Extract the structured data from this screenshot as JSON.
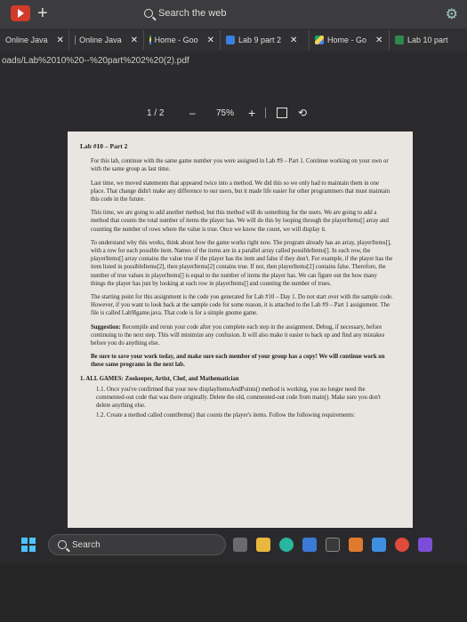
{
  "topbar": {
    "search_label": "Search the web"
  },
  "tabs": [
    {
      "label": "Online Java"
    },
    {
      "label": "Online Java"
    },
    {
      "label": "Home - Goo"
    },
    {
      "label": "Lab 9 part 2"
    },
    {
      "label": "Home - Go"
    },
    {
      "label": "Lab 10 part"
    }
  ],
  "address": {
    "url": "oads/Lab%2010%20--%20part%202%20(2).pdf"
  },
  "pdf_toolbar": {
    "page": "1 / 2",
    "minus": "–",
    "zoom": "75%",
    "plus": "+"
  },
  "document": {
    "title": "Lab #10 – Part 2",
    "paragraphs": [
      "For this lab, continue with the same game number you were assigned in Lab #9 – Part 1. Continue working on your own or with the same group as last time.",
      "Last time, we moved statements that appeared twice into a method. We did this so we only had to maintain them in one place. That change didn't make any difference to our users, but it made life easier for other programmers that must maintain this code in the future.",
      "This time, we are going to add another method, but this method will do something for the users. We are going to add a method that counts the total number of items the player has. We will do this by looping through the playerItems[] array and counting the number of rows where the value is true. Once we know the count, we will display it.",
      "To understand why this works, think about how the game works right now. The program already has an array, playerItems[], with a row for each possible item. Names of the items are in a parallel array called possibleItems[]. In each row, the playerItems[] array contains the value true if the player has the item and false if they don't. For example, if the player has the item listed in possibleItems[2], then playerItems[2] contains true. If not, then playerItems[2] contains false. Therefore, the number of true values in playerItems[] is equal to the number of items the player has. We can figure out the how many things the player has just by looking at each row in playerItems[] and counting the number of trues.",
      "The starting point for this assignment is the code you generated for Lab #10 – Day 1. Do not start over with the sample code. However, if you want to look back at the sample code for some reason, it is attached to the Lab #9 – Part 1 assignment. The file is called Lab9Igame.java. That code is for a simple gnome game."
    ],
    "suggestion_label": "Suggestion:",
    "suggestion_text": "Recompile and rerun your code after you complete each step in the assignment. Debug, if necessary, before continuing to the next step. This will minimize any confusion. It will also make it easier to back up and find any mistakes before you do anything else.",
    "save_note": "Be sure to save your work today, and make sure each member of your group has a copy! We will continue work on these same programs in the next lab.",
    "list_heading": "1.  ALL GAMES: Zookeeper, Artist, Chef, and Mathematician",
    "items": [
      "1.1. Once you've confirmed that your new displayItemsAndPoints() method is working, you no longer need the commented-out code that was there originally. Delete the old, commented-out code from main(). Make sure you don't delete anything else.",
      "1.2. Create a method called countItems() that counts the player's items. Follow the following requirements:"
    ]
  },
  "taskbar": {
    "search_label": "Search"
  }
}
